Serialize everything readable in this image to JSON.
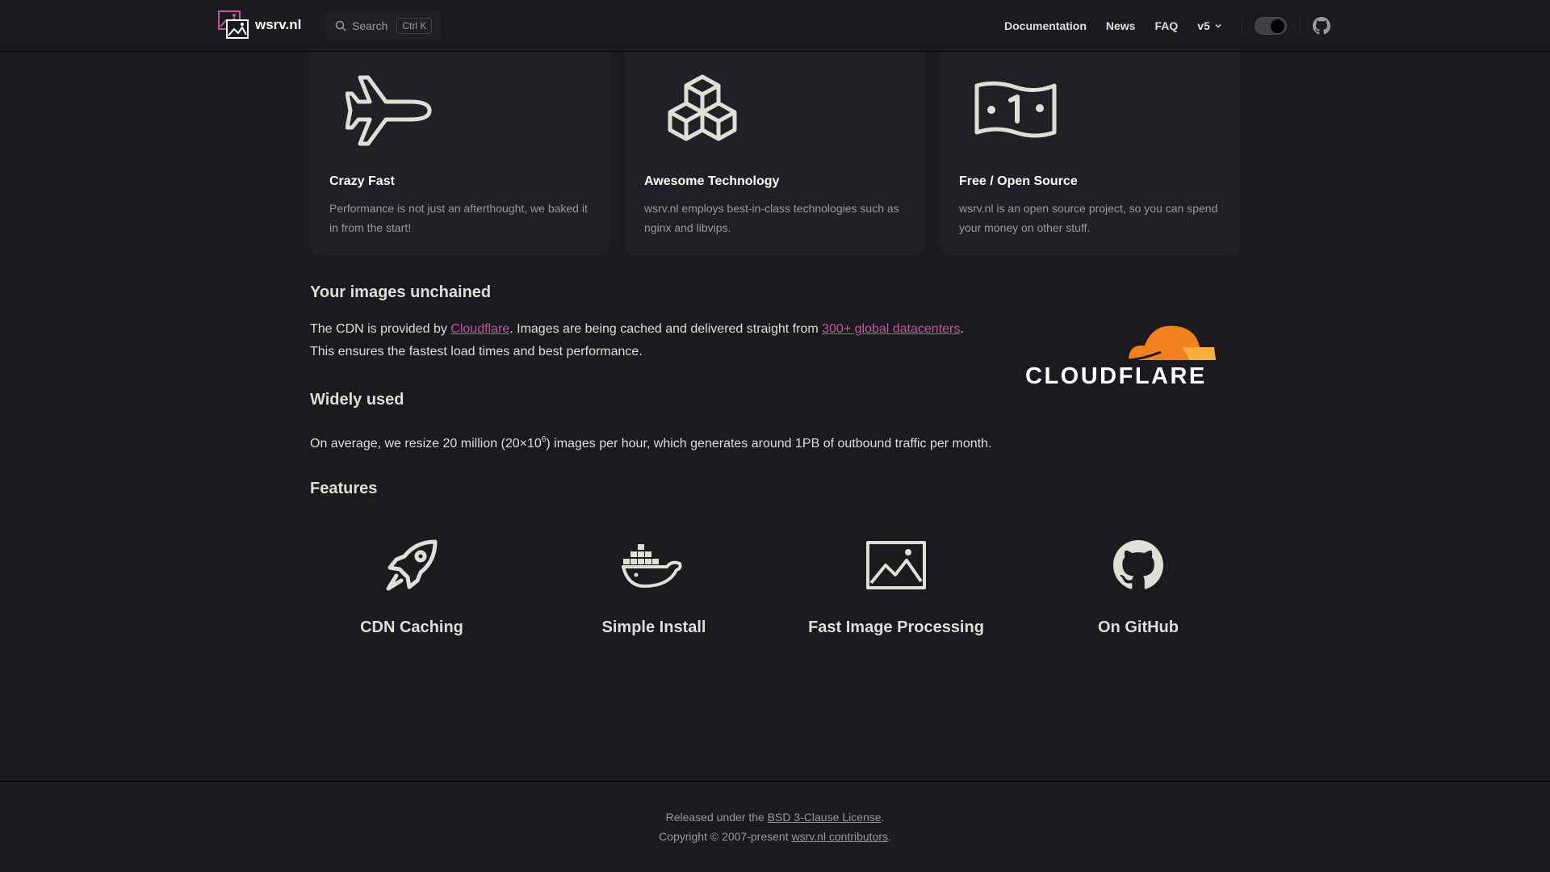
{
  "nav": {
    "site_name": "wsrv.nl",
    "search_label": "Search",
    "search_shortcut": "Ctrl K",
    "links": [
      "Documentation",
      "News",
      "FAQ"
    ],
    "version": "v5",
    "accent": "#c0579f"
  },
  "cards": [
    {
      "icon": "airplane-icon",
      "title": "Crazy Fast",
      "desc": "Performance is not just an afterthought, we baked it in from the start!"
    },
    {
      "icon": "cubes-icon",
      "title": "Awesome Technology",
      "desc": "wsrv.nl employs best-in-class technologies such as nginx and libvips."
    },
    {
      "icon": "money-bill-icon",
      "title": "Free / Open Source",
      "desc": "wsrv.nl is an open source project, so you can spend your money on other stuff."
    }
  ],
  "unchained": {
    "heading": "Your images unchained",
    "text1": "The CDN is provided by ",
    "link1": "Cloudflare",
    "text2": ". Images are being cached and delivered straight from ",
    "link2": "300+ global datacenters",
    "text3": ".",
    "text4": "This ensures the fastest load times and best performance.",
    "logo_text": "CLOUDFLARE",
    "logo_color": "#f38020"
  },
  "widely": {
    "heading": "Widely used",
    "text1": "On average, we resize 20 million (20×10",
    "sup": "6",
    "text2": ") images per hour, which generates around 1PB of outbound traffic per month."
  },
  "features": {
    "heading": "Features",
    "items": [
      {
        "icon": "rocket-icon",
        "label": "CDN Caching"
      },
      {
        "icon": "docker-icon",
        "label": "Simple Install"
      },
      {
        "icon": "image-icon",
        "label": "Fast Image Processing"
      },
      {
        "icon": "github-icon",
        "label": "On GitHub"
      }
    ]
  },
  "footer": {
    "line1_pre": "Released under the ",
    "line1_link": "BSD 3-Clause License",
    "line1_post": ".",
    "line2_pre": "Copyright © 2007-present ",
    "line2_link": "wsrv.nl contributors",
    "line2_post": "."
  }
}
